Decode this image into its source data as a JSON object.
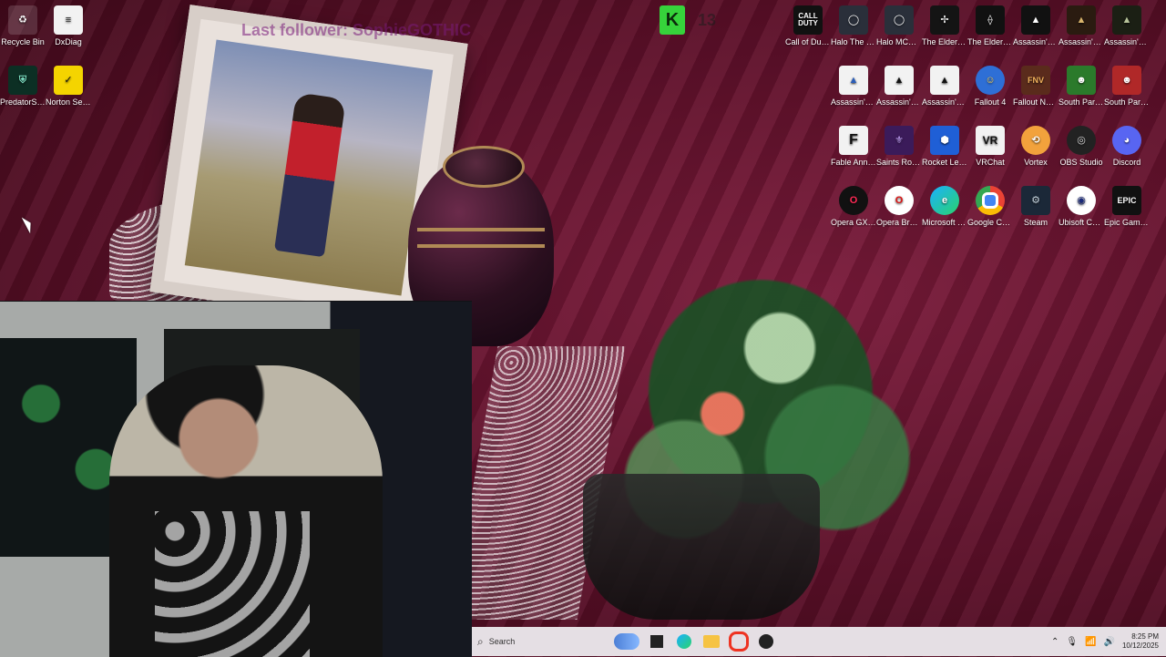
{
  "overlay": {
    "last_follower_text": "Last follower: SophieGOTHIC",
    "badge_k": "K",
    "badge_number": "13"
  },
  "desktop": {
    "left_icons": [
      {
        "label": "Recycle Bin",
        "icon": "recycle-bin-icon"
      },
      {
        "label": "DxDiag",
        "icon": "document-icon"
      },
      {
        "label": "PredatorSe...",
        "icon": "predator-icon"
      },
      {
        "label": "Norton Security Ultra",
        "icon": "norton-icon"
      }
    ],
    "right_icons": [
      {
        "label": "Call of Duty®",
        "icon": "call-of-duty-icon"
      },
      {
        "label": "Halo The Master Chi...",
        "icon": "halo-icon"
      },
      {
        "label": "Halo MCC Anti-Che...",
        "icon": "halo-mcc-icon"
      },
      {
        "label": "The Elder Scrolls ...",
        "icon": "elder-scrolls-icon"
      },
      {
        "label": "The Elder Scrolls IV ...",
        "icon": "elder-scrolls-iv-icon"
      },
      {
        "label": "Assassin's Creed S...",
        "icon": "assassins-creed-icon"
      },
      {
        "label": "Assassin's Creed Mirage",
        "icon": "assassins-creed-mirage-icon"
      },
      {
        "label": "Assassin's Creed O...",
        "icon": "assassins-creed-origins-icon"
      },
      {
        "label": "Assassin's Creed Unity",
        "icon": "assassins-creed-unity-icon"
      },
      {
        "label": "Assassin's Creed Lib...",
        "icon": "assassins-creed-liberation-icon"
      },
      {
        "label": "Assassin's Creed® ...",
        "icon": "assassins-creed-2-icon"
      },
      {
        "label": "Fallout 4",
        "icon": "fallout-4-icon"
      },
      {
        "label": "Fallout New Vegas Ulti...",
        "icon": "fallout-new-vegas-icon"
      },
      {
        "label": "South Park TSOT",
        "icon": "south-park-tsot-icon"
      },
      {
        "label": "South Park - The Fractur...",
        "icon": "south-park-fractured-icon"
      },
      {
        "label": "Fable Anniversary",
        "icon": "fable-icon"
      },
      {
        "label": "Saints Row 2",
        "icon": "saints-row-icon"
      },
      {
        "label": "Rocket League®",
        "icon": "rocket-league-icon"
      },
      {
        "label": "VRChat",
        "icon": "vrchat-icon"
      },
      {
        "label": "Vortex",
        "icon": "vortex-icon"
      },
      {
        "label": "OBS Studio",
        "icon": "obs-icon"
      },
      {
        "label": "Discord",
        "icon": "discord-icon"
      },
      {
        "label": "Opera GX Browser",
        "icon": "opera-gx-icon"
      },
      {
        "label": "Opera Browser",
        "icon": "opera-icon"
      },
      {
        "label": "Microsoft Edge",
        "icon": "edge-icon"
      },
      {
        "label": "Google Chrome",
        "icon": "chrome-icon"
      },
      {
        "label": "Steam",
        "icon": "steam-icon"
      },
      {
        "label": "Ubisoft Connect",
        "icon": "ubisoft-icon"
      },
      {
        "label": "Epic Games Launcher",
        "icon": "epic-games-icon"
      }
    ]
  },
  "taskbar": {
    "search_placeholder": "Search",
    "time": "8:25 PM",
    "date": "10/12/2025",
    "pinned": [
      {
        "name": "taskbar-widget-icon"
      },
      {
        "name": "taskbar-terminal-icon"
      },
      {
        "name": "taskbar-edge-icon"
      },
      {
        "name": "taskbar-file-explorer-icon"
      },
      {
        "name": "taskbar-opera-icon"
      },
      {
        "name": "taskbar-obs-icon"
      }
    ]
  },
  "colors": {
    "accent_green": "#36d33b",
    "follower_purple": "#7a1b7a"
  }
}
